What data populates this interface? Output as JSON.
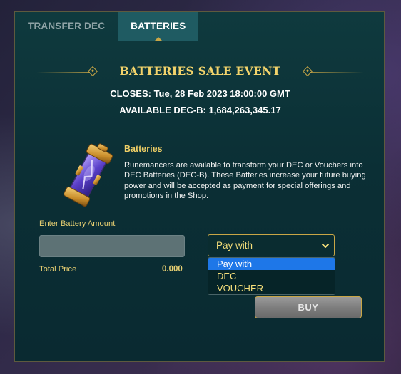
{
  "tabs": [
    {
      "label": "TRANSFER DEC",
      "active": false
    },
    {
      "label": "BATTERIES",
      "active": true
    }
  ],
  "event": {
    "title": "BATTERIES SALE EVENT",
    "closes": "CLOSES: Tue, 28 Feb 2023 18:00:00 GMT",
    "available": "AVAILABLE DEC-B: 1,684,263,345.17"
  },
  "info": {
    "heading": "Batteries",
    "body": "Runemancers are available to transform your DEC or Vouchers into DEC Batteries (DEC-B). These Batteries increase your future buying power and will be accepted as payment for special offerings and promotions in the Shop."
  },
  "form": {
    "amount_label": "Enter Battery Amount",
    "amount_value": "",
    "total_label": "Total Price",
    "total_value": "0.000",
    "pay_with": {
      "selected": "Pay with",
      "options": [
        "Pay with",
        "DEC",
        "VOUCHER"
      ],
      "highlighted_index": 0
    },
    "buy_label": "BUY"
  },
  "colors": {
    "accent_gold": "#c9a646",
    "title_gold": "#f2d36b",
    "panel_bg": "#0b2f35",
    "active_tab_bg": "#1f5b62",
    "dropdown_highlight": "#1e77e8"
  },
  "icons": {
    "battery": "battery-crystal-icon",
    "chevron": "chevron-down-icon",
    "ornament": "diamond-ornament-icon"
  }
}
